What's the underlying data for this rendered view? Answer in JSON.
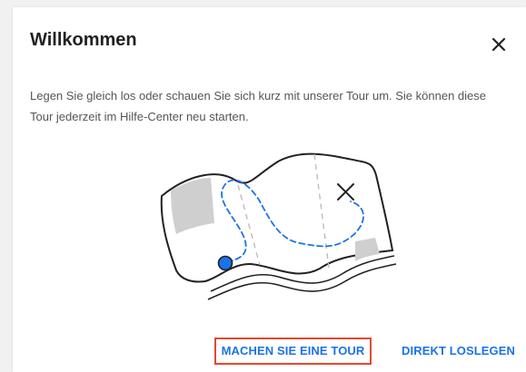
{
  "dialog": {
    "title": "Willkommen",
    "close_icon": "close-icon",
    "description": "Legen Sie gleich los oder schauen Sie sich kurz mit unserer Tour um. Sie können diese Tour jederzeit im Hilfe-Center neu starten.",
    "illustration_icon": "treasure-map-illustration",
    "buttons": {
      "tour_label": "MACHEN SIE EINE TOUR",
      "start_label": "DIREKT LOSLEGEN"
    }
  },
  "colors": {
    "accent": "#1a73e8",
    "highlight_border": "#e24a2d",
    "title": "#222222",
    "text": "#555555",
    "map_marker": "#1a73e8",
    "map_path": "#1a73e8"
  }
}
